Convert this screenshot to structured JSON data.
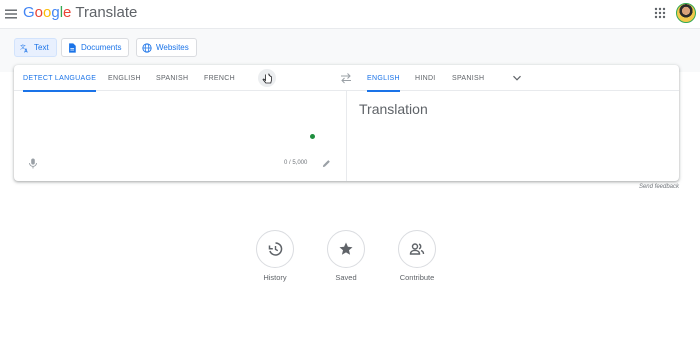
{
  "header": {
    "logo_google": [
      "G",
      "o",
      "o",
      "g",
      "l",
      "e"
    ],
    "product": "Translate",
    "menu_icon": "hamburger-menu-icon",
    "apps_icon": "apps-grid-icon"
  },
  "modes": [
    {
      "label": "Text",
      "icon": "translate-text-icon",
      "active": true
    },
    {
      "label": "Documents",
      "icon": "document-icon",
      "active": false
    },
    {
      "label": "Websites",
      "icon": "globe-icon",
      "active": false
    }
  ],
  "source_langs": [
    "DETECT LANGUAGE",
    "ENGLISH",
    "SPANISH",
    "FRENCH"
  ],
  "target_langs": [
    "ENGLISH",
    "HINDI",
    "SPANISH"
  ],
  "source": {
    "value": "",
    "char_count": "0 / 5,000"
  },
  "target": {
    "placeholder": "Translation"
  },
  "feedback": "Send feedback",
  "actions": [
    {
      "label": "History",
      "icon": "history-icon"
    },
    {
      "label": "Saved",
      "icon": "star-icon"
    },
    {
      "label": "Contribute",
      "icon": "people-icon"
    }
  ],
  "colors": {
    "accent": "#1a73e8",
    "active_tab_bg": "#e8f0fe",
    "band_bg": "#f8f9fa",
    "status_dot": "#1e8e3e"
  }
}
